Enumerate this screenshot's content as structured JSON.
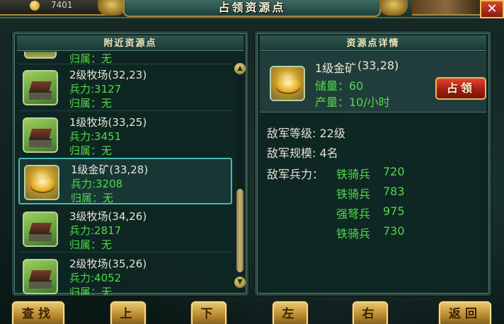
{
  "topbar": {
    "gold_amount": "7401",
    "title": "占领资源点",
    "close_label": "✕"
  },
  "left_panel": {
    "title": "附近资源点",
    "partial_row": {
      "owner": "归属：无"
    },
    "rows": [
      {
        "name": "2级牧场(32,23)",
        "troops": "兵力:3127",
        "owner": "归属：无",
        "kind": "farm"
      },
      {
        "name": "1级牧场(33,25)",
        "troops": "兵力:3451",
        "owner": "归属：无",
        "kind": "farm"
      },
      {
        "name": "1级金矿(33,28)",
        "troops": "兵力:3208",
        "owner": "归属：无",
        "kind": "gold",
        "selected": true
      },
      {
        "name": "3级牧场(34,26)",
        "troops": "兵力:2817",
        "owner": "归属：无",
        "kind": "farm"
      },
      {
        "name": "2级牧场(35,26)",
        "troops": "兵力:4052",
        "owner": "归属：无",
        "kind": "farm"
      }
    ],
    "scroll_up_icon": "chevron-up-icon",
    "scroll_down_icon": "chevron-down-icon",
    "scroll_position": 0.6
  },
  "right_panel": {
    "title": "资源点详情",
    "name": "1级金矿",
    "coords": "(33,28)",
    "reserve": "储量：60",
    "output": "产量：10/小时",
    "occupy_label": "占领",
    "enemy_level": "敌军等级: 22级",
    "enemy_scale": "敌军规模: 4名",
    "enemy_troops_label": "敌军兵力：",
    "units": [
      {
        "type": "铁骑兵",
        "count": "720"
      },
      {
        "type": "铁骑兵",
        "count": "783"
      },
      {
        "type": "强弩兵",
        "count": "975"
      },
      {
        "type": "铁骑兵",
        "count": "730"
      }
    ]
  },
  "bottom_bar": {
    "find": "查找",
    "up": "上",
    "down": "下",
    "left": "左",
    "right": "右",
    "back": "返回"
  },
  "colors": {
    "accent_gold": "#e7c66c",
    "green_text": "#52d94a",
    "selection": "#49b8b2",
    "occupy_red": "#a41e12"
  }
}
